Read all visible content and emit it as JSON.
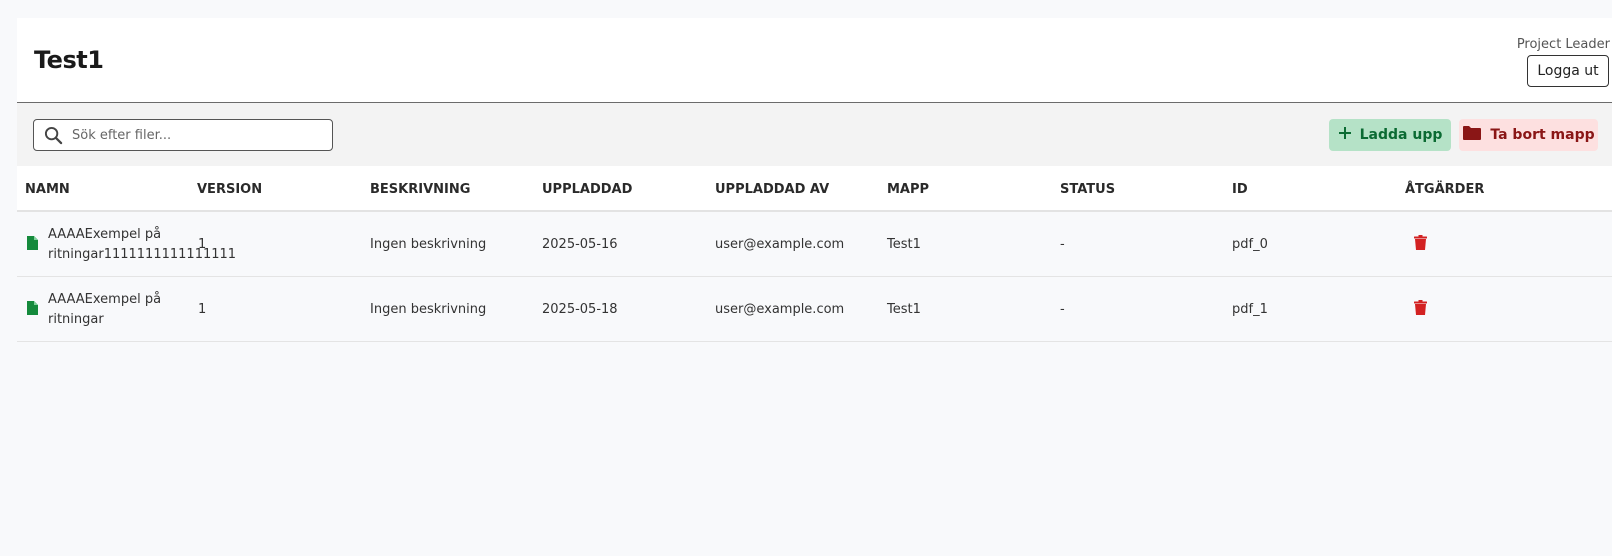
{
  "header": {
    "title": "Test1",
    "role": "Project Leader",
    "logout_label": "Logga ut"
  },
  "toolbar": {
    "search_placeholder": "Sök efter filer...",
    "upload_label": "Ladda upp",
    "delete_folder_label": "Ta bort mapp"
  },
  "table": {
    "columns": [
      "NAMN",
      "VERSION",
      "BESKRIVNING",
      "UPPLADDAD",
      "UPPLADDAD AV",
      "MAPP",
      "STATUS",
      "ID",
      "ÅTGÄRDER"
    ],
    "rows": [
      {
        "name_line1": "AAAAExempel på",
        "name_line2": "ritningar1111111111111111",
        "version": "1",
        "description": "Ingen beskrivning",
        "uploaded": "2025-05-16",
        "uploaded_by": "user@example.com",
        "folder": "Test1",
        "status": "-",
        "id": "pdf_0"
      },
      {
        "name_line1": "AAAAExempel på",
        "name_line2": "ritningar",
        "version": "1",
        "description": "Ingen beskrivning",
        "uploaded": "2025-05-18",
        "uploaded_by": "user@example.com",
        "folder": "Test1",
        "status": "-",
        "id": "pdf_1"
      }
    ]
  },
  "colors": {
    "upload_bg": "#b5e2c7",
    "upload_text": "#0b6b33",
    "delete_bg": "#fde0e0",
    "delete_text": "#8a1616",
    "trash": "#d32222",
    "file_icon": "#158a3c"
  },
  "icons": {
    "search": "search-icon",
    "upload": "plus-icon",
    "delete_folder": "folder-icon",
    "file": "file-icon",
    "delete_row": "trash-icon"
  }
}
